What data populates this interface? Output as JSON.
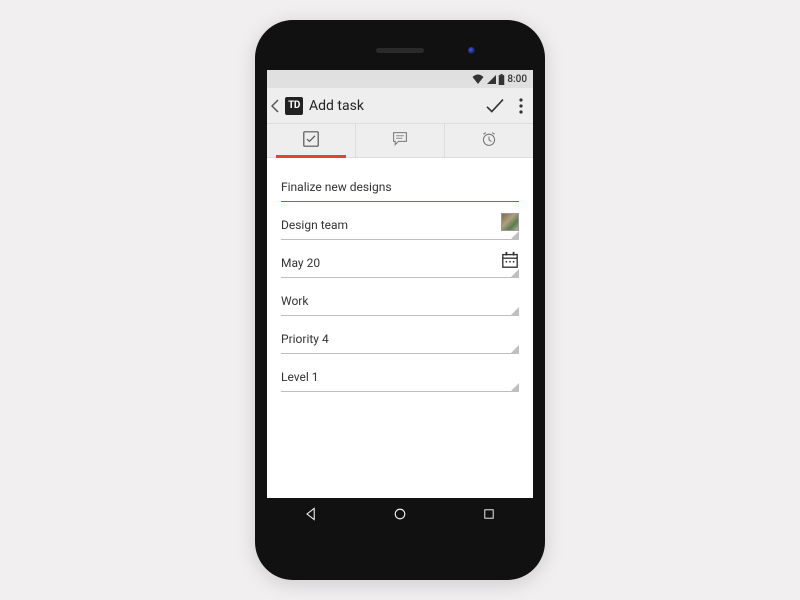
{
  "status": {
    "time": "8:00"
  },
  "appbar": {
    "logo_text": "TD",
    "title": "Add task"
  },
  "task": {
    "name": "Finalize new designs",
    "assignee": "Design team",
    "date": "May 20",
    "project": "Work",
    "priority": "Priority 4",
    "level": "Level 1"
  }
}
